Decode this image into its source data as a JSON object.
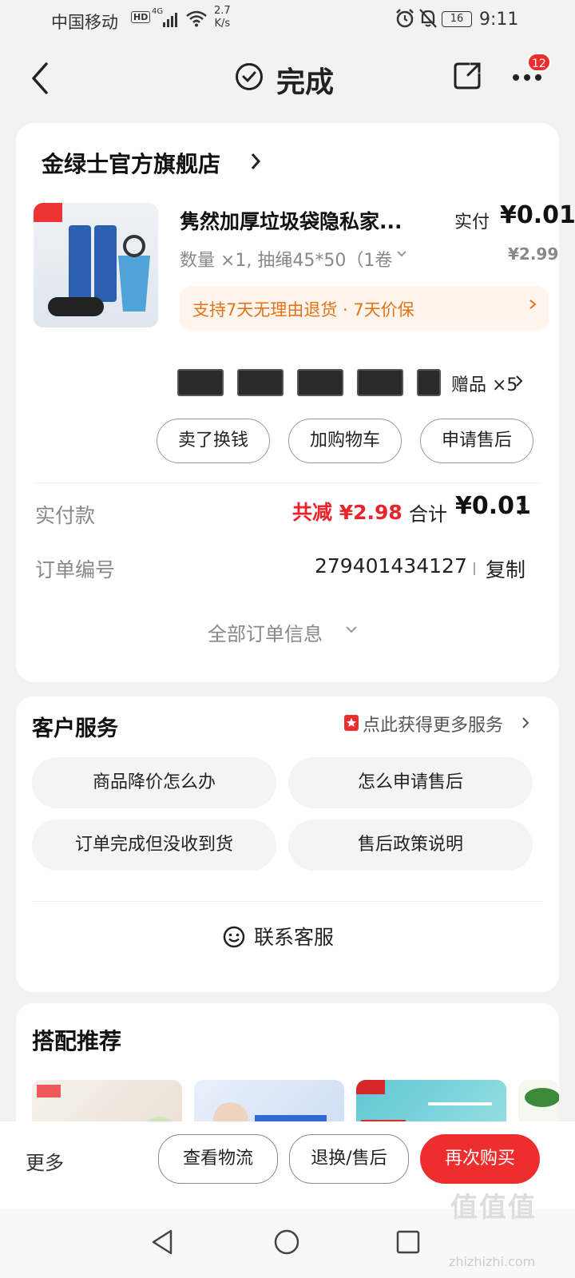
{
  "status_bar": {
    "carrier": "中国移动",
    "hd": "HD",
    "network": "4G",
    "speed_value": "2.7",
    "speed_unit": "K/s",
    "battery": "16",
    "time": "9:11"
  },
  "nav": {
    "title": "完成",
    "badge_count": "12"
  },
  "order": {
    "shop_name": "金绿士官方旗舰店",
    "product_title": "隽然加厚垃圾袋隐私家...",
    "paid_label": "实付",
    "paid_amount": "¥0.01",
    "spec": "数量 ×1, 抽绳45*50（1卷",
    "original_price": "¥2.99",
    "guarantee": "支持7天无理由退货 · 7天价保",
    "gift_label": "赠品 ×5",
    "actions": [
      "卖了换钱",
      "加购物车",
      "申请售后"
    ],
    "paid_row_label": "实付款",
    "saving": "共减 ¥2.98",
    "total_label": "合计",
    "total_amount": "¥0.01",
    "order_no_label": "订单编号",
    "order_no": "279401434127",
    "copy_label": "复制",
    "all_info": "全部订单信息"
  },
  "service": {
    "title": "客户服务",
    "more": "点此获得更多服务",
    "options": [
      "商品降价怎么办",
      "怎么申请售后",
      "订单完成但没收到货",
      "售后政策说明"
    ],
    "contact": "联系客服"
  },
  "recommend": {
    "title": "搭配推荐"
  },
  "bottom_bar": {
    "more": "更多",
    "logistics": "查看物流",
    "return": "退换/售后",
    "buy_again": "再次购买"
  },
  "watermark": {
    "logo": "值值值",
    "url": "zhizhizhi.com"
  },
  "colors": {
    "accent": "#ee2e2e",
    "guarantee": "#e2741a"
  }
}
